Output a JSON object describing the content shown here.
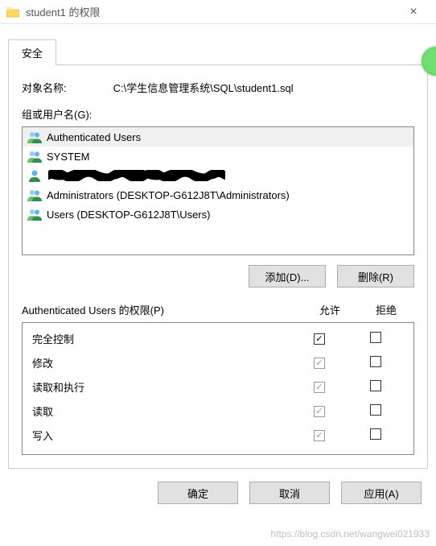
{
  "titlebar": {
    "title": "student1 的权限",
    "close": "×"
  },
  "tab": {
    "security": "安全"
  },
  "object": {
    "label": "对象名称:",
    "value": "C:\\学生信息管理系统\\SQL\\student1.sql"
  },
  "groups": {
    "label": "组或用户名(G):",
    "items": [
      {
        "name": "Authenticated Users",
        "icon": "two"
      },
      {
        "name": "SYSTEM",
        "icon": "two"
      },
      {
        "name": "",
        "icon": "one",
        "redacted": true
      },
      {
        "name": "Administrators (DESKTOP-G612J8T\\Administrators)",
        "icon": "two"
      },
      {
        "name": "Users (DESKTOP-G612J8T\\Users)",
        "icon": "two"
      }
    ],
    "add_btn": "添加(D)...",
    "remove_btn": "删除(R)"
  },
  "perm": {
    "title": "Authenticated Users 的权限(P)",
    "allow": "允许",
    "deny": "拒绝",
    "rows": [
      {
        "label": "完全控制",
        "allow": true,
        "allow_disabled": false,
        "deny": false
      },
      {
        "label": "修改",
        "allow": true,
        "allow_disabled": true,
        "deny": false
      },
      {
        "label": "读取和执行",
        "allow": true,
        "allow_disabled": true,
        "deny": false
      },
      {
        "label": "读取",
        "allow": true,
        "allow_disabled": true,
        "deny": false
      },
      {
        "label": "写入",
        "allow": true,
        "allow_disabled": true,
        "deny": false
      }
    ]
  },
  "footer": {
    "ok": "确定",
    "cancel": "取消",
    "apply": "应用(A)"
  },
  "watermark": "https://blog.csdn.net/wangwei021933"
}
